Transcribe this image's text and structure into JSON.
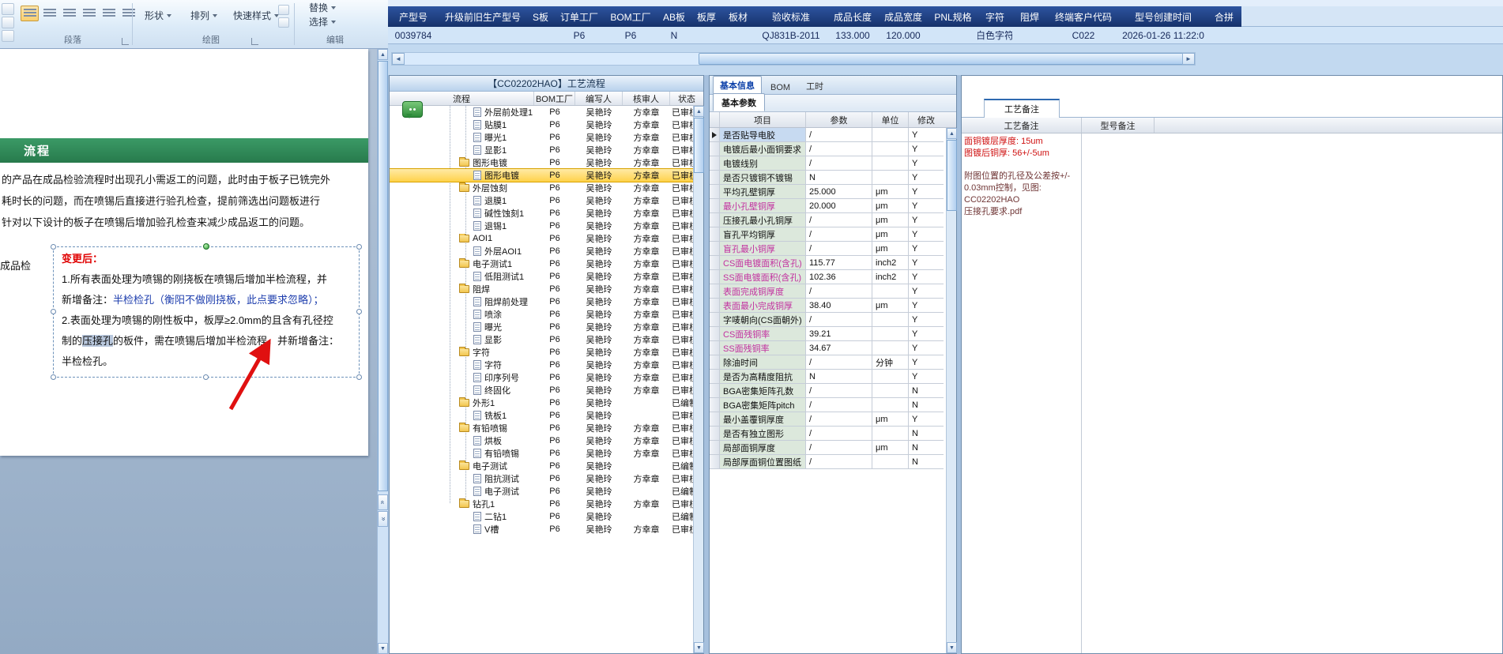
{
  "colors": {
    "header_navy": "#16316a",
    "selection_yellow": "#ffd24a",
    "green_band": "#2e8b57",
    "red_text": "#e00000",
    "blue_text": "#1f3fae",
    "pink_text": "#c2309f"
  },
  "ribbon": {
    "paragraph_label": "段落",
    "drawing_label": "绘图",
    "editing_label": "编辑",
    "shapes": "形状",
    "arrange": "排列",
    "quick_styles": "快速样式",
    "replace": "替换",
    "select": "选择"
  },
  "top_table": {
    "columns": [
      "产型号",
      "升级前旧生产型号",
      "S板",
      "订单工厂",
      "BOM工厂",
      "AB板",
      "板厚",
      "板材",
      "验收标准",
      "成品长度",
      "成品宽度",
      "PNL规格",
      "字符",
      "阻焊",
      "终端客户代码",
      "型号创建时间",
      "合拼"
    ],
    "values": [
      "0039784",
      "",
      "",
      "P6",
      "P6",
      "N",
      "",
      "",
      "QJ831B-2011",
      "133.000",
      "120.000",
      "",
      "白色字符",
      "",
      "C022",
      "2026-01-26 11:22:0",
      ""
    ]
  },
  "document": {
    "section_header": "流程",
    "body_lines": [
      "的产品在成品检验流程时出现孔小需返工的问题，此时由于板子已铣完外",
      "耗时长的问题，而在喷锡后直接进行验孔检查，提前筛选出问题板进行",
      "针对以下设计的板子在喷锡后增加验孔检查来减少成品返工的问题。"
    ],
    "margin_text": "成品检",
    "change_title": "变更后：",
    "change_lines": [
      [
        {
          "t": "1.所有表面处理为喷锡的刚挠板在喷锡后增加半检流程，并",
          "s": "k"
        }
      ],
      [
        {
          "t": "新增备注：",
          "s": "k"
        },
        {
          "t": "半检检孔（衡阳不做刚挠板，此点要求忽略）；",
          "s": "b"
        }
      ],
      [
        {
          "t": "2.表面处理为喷锡的刚性板中，板厚≥2.0mm的且含有孔径控",
          "s": "k"
        }
      ],
      [
        {
          "t": "制的",
          "s": "k"
        },
        {
          "t": "压接孔",
          "s": "hl"
        },
        {
          "t": "的板件，需在喷锡后增加半检流程，并新增备注：",
          "s": "k"
        }
      ],
      [
        {
          "t": "半检检孔。",
          "s": "k"
        }
      ]
    ]
  },
  "flow_window": {
    "title": "【CC02202HAO】工艺流程",
    "columns": [
      "流程",
      "BOM工厂",
      "编写人",
      "核审人",
      "状态"
    ],
    "rows": [
      {
        "name": "外层前处理1",
        "type": "doc",
        "level": 2,
        "bom": "P6",
        "writer": "吴艳玲",
        "auditor": "方幸章",
        "status": "已审核",
        "selected": false
      },
      {
        "name": "贴膜1",
        "type": "doc",
        "level": 2,
        "bom": "P6",
        "writer": "吴艳玲",
        "auditor": "方幸章",
        "status": "已审核",
        "selected": false
      },
      {
        "name": "曝光1",
        "type": "doc",
        "level": 2,
        "bom": "P6",
        "writer": "吴艳玲",
        "auditor": "方幸章",
        "status": "已审核",
        "selected": false
      },
      {
        "name": "显影1",
        "type": "doc",
        "level": 2,
        "bom": "P6",
        "writer": "吴艳玲",
        "auditor": "方幸章",
        "status": "已审核",
        "selected": false
      },
      {
        "name": "图形电镀",
        "type": "folder",
        "level": 1,
        "bom": "P6",
        "writer": "吴艳玲",
        "auditor": "方幸章",
        "status": "已审核",
        "selected": false
      },
      {
        "name": "图形电镀",
        "type": "doc",
        "level": 2,
        "bom": "P6",
        "writer": "吴艳玲",
        "auditor": "方幸章",
        "status": "已审核",
        "selected": true
      },
      {
        "name": "外层蚀刻",
        "type": "folder",
        "level": 1,
        "bom": "P6",
        "writer": "吴艳玲",
        "auditor": "方幸章",
        "status": "已审核",
        "selected": false
      },
      {
        "name": "退膜1",
        "type": "doc",
        "level": 2,
        "bom": "P6",
        "writer": "吴艳玲",
        "auditor": "方幸章",
        "status": "已审核",
        "selected": false
      },
      {
        "name": "碱性蚀刻1",
        "type": "doc",
        "level": 2,
        "bom": "P6",
        "writer": "吴艳玲",
        "auditor": "方幸章",
        "status": "已审核",
        "selected": false
      },
      {
        "name": "退锡1",
        "type": "doc",
        "level": 2,
        "bom": "P6",
        "writer": "吴艳玲",
        "auditor": "方幸章",
        "status": "已审核",
        "selected": false
      },
      {
        "name": "AOI1",
        "type": "folder",
        "level": 1,
        "bom": "P6",
        "writer": "吴艳玲",
        "auditor": "方幸章",
        "status": "已审核",
        "selected": false
      },
      {
        "name": "外层AOI1",
        "type": "doc",
        "level": 2,
        "bom": "P6",
        "writer": "吴艳玲",
        "auditor": "方幸章",
        "status": "已审核",
        "selected": false
      },
      {
        "name": "电子测试1",
        "type": "folder",
        "level": 1,
        "bom": "P6",
        "writer": "吴艳玲",
        "auditor": "方幸章",
        "status": "已审核",
        "selected": false
      },
      {
        "name": "低阻测试1",
        "type": "doc",
        "level": 2,
        "bom": "P6",
        "writer": "吴艳玲",
        "auditor": "方幸章",
        "status": "已审核",
        "selected": false
      },
      {
        "name": "阻焊",
        "type": "folder",
        "level": 1,
        "bom": "P6",
        "writer": "吴艳玲",
        "auditor": "方幸章",
        "status": "已审核",
        "selected": false
      },
      {
        "name": "阻焊前处理",
        "type": "doc",
        "level": 2,
        "bom": "P6",
        "writer": "吴艳玲",
        "auditor": "方幸章",
        "status": "已审核",
        "selected": false
      },
      {
        "name": "喷涂",
        "type": "doc",
        "level": 2,
        "bom": "P6",
        "writer": "吴艳玲",
        "auditor": "方幸章",
        "status": "已审核",
        "selected": false
      },
      {
        "name": "曝光",
        "type": "doc",
        "level": 2,
        "bom": "P6",
        "writer": "吴艳玲",
        "auditor": "方幸章",
        "status": "已审核",
        "selected": false
      },
      {
        "name": "显影",
        "type": "doc",
        "level": 2,
        "bom": "P6",
        "writer": "吴艳玲",
        "auditor": "方幸章",
        "status": "已审核",
        "selected": false
      },
      {
        "name": "字符",
        "type": "folder",
        "level": 1,
        "bom": "P6",
        "writer": "吴艳玲",
        "auditor": "方幸章",
        "status": "已审核",
        "selected": false
      },
      {
        "name": "字符",
        "type": "doc",
        "level": 2,
        "bom": "P6",
        "writer": "吴艳玲",
        "auditor": "方幸章",
        "status": "已审核",
        "selected": false
      },
      {
        "name": "印序列号",
        "type": "doc",
        "level": 2,
        "bom": "P6",
        "writer": "吴艳玲",
        "auditor": "方幸章",
        "status": "已审核",
        "selected": false
      },
      {
        "name": "终固化",
        "type": "doc",
        "level": 2,
        "bom": "P6",
        "writer": "吴艳玲",
        "auditor": "方幸章",
        "status": "已审核",
        "selected": false
      },
      {
        "name": "外形1",
        "type": "folder",
        "level": 1,
        "bom": "P6",
        "writer": "吴艳玲",
        "auditor": "",
        "status": "已编制",
        "selected": false
      },
      {
        "name": "铣板1",
        "type": "doc",
        "level": 2,
        "bom": "P6",
        "writer": "吴艳玲",
        "auditor": "",
        "status": "已审核",
        "selected": false
      },
      {
        "name": "有铅喷锡",
        "type": "folder",
        "level": 1,
        "bom": "P6",
        "writer": "吴艳玲",
        "auditor": "方幸章",
        "status": "已审核",
        "selected": false
      },
      {
        "name": "烘板",
        "type": "doc",
        "level": 2,
        "bom": "P6",
        "writer": "吴艳玲",
        "auditor": "方幸章",
        "status": "已审核",
        "selected": false
      },
      {
        "name": "有铅喷锡",
        "type": "doc",
        "level": 2,
        "bom": "P6",
        "writer": "吴艳玲",
        "auditor": "方幸章",
        "status": "已审核",
        "selected": false
      },
      {
        "name": "电子测试",
        "type": "folder",
        "level": 1,
        "bom": "P6",
        "writer": "吴艳玲",
        "auditor": "",
        "status": "已编制",
        "selected": false
      },
      {
        "name": "阻抗测试",
        "type": "doc",
        "level": 2,
        "bom": "P6",
        "writer": "吴艳玲",
        "auditor": "方幸章",
        "status": "已审核",
        "selected": false
      },
      {
        "name": "电子测试",
        "type": "doc",
        "level": 2,
        "bom": "P6",
        "writer": "吴艳玲",
        "auditor": "",
        "status": "已编制",
        "selected": false
      },
      {
        "name": "钻孔1",
        "type": "folder",
        "level": 1,
        "bom": "P6",
        "writer": "吴艳玲",
        "auditor": "方幸章",
        "status": "已审核",
        "selected": false
      },
      {
        "name": "二钻1",
        "type": "doc",
        "level": 2,
        "bom": "P6",
        "writer": "吴艳玲",
        "auditor": "",
        "status": "已编制",
        "selected": false
      },
      {
        "name": "V槽",
        "type": "doc",
        "level": 2,
        "bom": "P6",
        "writer": "吴艳玲",
        "auditor": "方幸章",
        "status": "已审核",
        "selected": false
      }
    ]
  },
  "params_window": {
    "tabs": [
      "基本信息",
      "BOM",
      "工时"
    ],
    "active_tab": "基本信息",
    "sub_tab": "基本参数",
    "columns": [
      "项目",
      "参数",
      "单位",
      "修改"
    ],
    "rows": [
      {
        "item": "是否贴导电胶",
        "param": "/",
        "unit": "",
        "flag": "Y",
        "pink": false,
        "selected": true
      },
      {
        "item": "电镀后最小面铜要求",
        "param": "/",
        "unit": "",
        "flag": "Y",
        "pink": false,
        "selected": false
      },
      {
        "item": "电镀线别",
        "param": "/",
        "unit": "",
        "flag": "Y",
        "pink": false,
        "selected": false
      },
      {
        "item": "是否只镀铜不镀锡",
        "param": "N",
        "unit": "",
        "flag": "Y",
        "pink": false,
        "selected": false
      },
      {
        "item": "平均孔壁铜厚",
        "param": "25.000",
        "unit": "μm",
        "flag": "Y",
        "pink": false,
        "selected": false
      },
      {
        "item": "最小孔壁铜厚",
        "param": "20.000",
        "unit": "μm",
        "flag": "Y",
        "pink": true,
        "selected": false
      },
      {
        "item": "压接孔最小孔铜厚",
        "param": "/",
        "unit": "μm",
        "flag": "Y",
        "pink": false,
        "selected": false
      },
      {
        "item": "盲孔平均铜厚",
        "param": "/",
        "unit": "μm",
        "flag": "Y",
        "pink": false,
        "selected": false
      },
      {
        "item": "盲孔最小铜厚",
        "param": "/",
        "unit": "μm",
        "flag": "Y",
        "pink": true,
        "selected": false
      },
      {
        "item": "CS面电镀面积(含孔)",
        "param": "115.77",
        "unit": "inch2",
        "flag": "Y",
        "pink": true,
        "selected": false
      },
      {
        "item": "SS面电镀面积(含孔)",
        "param": "102.36",
        "unit": "inch2",
        "flag": "Y",
        "pink": true,
        "selected": false
      },
      {
        "item": "表面完成铜厚度",
        "param": "/",
        "unit": "",
        "flag": "Y",
        "pink": true,
        "selected": false
      },
      {
        "item": "表面最小完成铜厚",
        "param": "38.40",
        "unit": "μm",
        "flag": "Y",
        "pink": true,
        "selected": false
      },
      {
        "item": "字唛朝向(CS面朝外)",
        "param": "/",
        "unit": "",
        "flag": "Y",
        "pink": false,
        "selected": false
      },
      {
        "item": "CS面残铜率",
        "param": "39.21",
        "unit": "",
        "flag": "Y",
        "pink": true,
        "selected": false
      },
      {
        "item": "SS面残铜率",
        "param": "34.67",
        "unit": "",
        "flag": "Y",
        "pink": true,
        "selected": false
      },
      {
        "item": "除油时间",
        "param": "/",
        "unit": "分钟",
        "flag": "Y",
        "pink": false,
        "selected": false
      },
      {
        "item": "是否为高精度阻抗",
        "param": "N",
        "unit": "",
        "flag": "Y",
        "pink": false,
        "selected": false
      },
      {
        "item": "BGA密集矩阵孔数",
        "param": "/",
        "unit": "",
        "flag": "N",
        "pink": false,
        "selected": false
      },
      {
        "item": "BGA密集矩阵pitch",
        "param": "/",
        "unit": "",
        "flag": "N",
        "pink": false,
        "selected": false
      },
      {
        "item": "最小盖覆铜厚度",
        "param": "/",
        "unit": "μm",
        "flag": "Y",
        "pink": false,
        "selected": false
      },
      {
        "item": "是否有独立图形",
        "param": "/",
        "unit": "",
        "flag": "N",
        "pink": false,
        "selected": false
      },
      {
        "item": "局部面铜厚度",
        "param": "/",
        "unit": "μm",
        "flag": "N",
        "pink": false,
        "selected": false
      },
      {
        "item": "局部厚面铜位置图纸",
        "param": "/",
        "unit": "",
        "flag": "N",
        "pink": false,
        "selected": false
      }
    ]
  },
  "notes_window": {
    "tab": "工艺备注",
    "col1_header": "工艺备注",
    "col2_header": "型号备注",
    "red_lines": [
      "面铜镀层厚度: 15um",
      "图镀后铜厚: 56+/-5um"
    ],
    "dark_lines": [
      "附图位置的孔径及公差按+/-",
      "0.03mm控制，见图: CC02202HAO",
      "压接孔要求.pdf"
    ]
  }
}
